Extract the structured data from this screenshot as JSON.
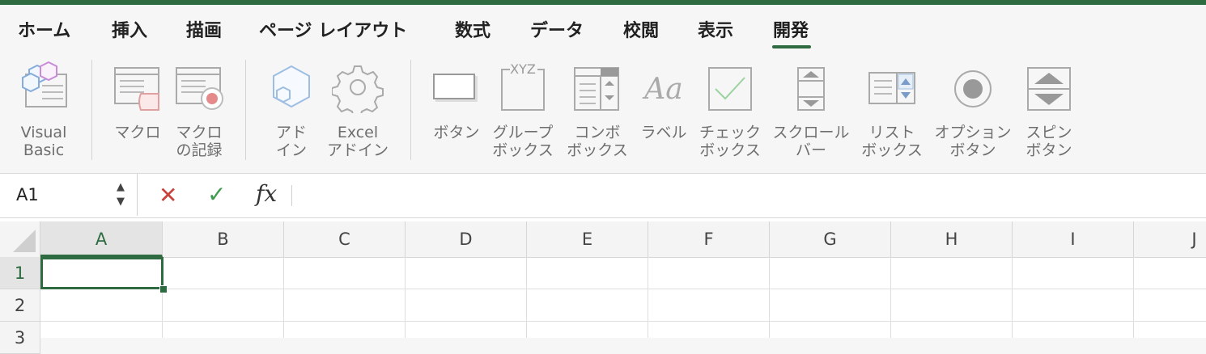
{
  "ribbon_tabs": [
    {
      "label": "ホーム"
    },
    {
      "label": "挿入"
    },
    {
      "label": "描画"
    },
    {
      "label": "ページ レイアウト"
    },
    {
      "label": "数式"
    },
    {
      "label": "データ"
    },
    {
      "label": "校閲"
    },
    {
      "label": "表示"
    },
    {
      "label": "開発",
      "active": true
    }
  ],
  "ribbon": {
    "visual_basic": "Visual\nBasic",
    "macro": "マクロ",
    "record_macro": "マクロ\nの記録",
    "addins": "アド\nイン",
    "excel_addins": "Excel\nアドイン",
    "button": "ボタン",
    "group_box": "グループ\nボックス",
    "combo_box": "コンボ\nボックス",
    "label": "ラベル",
    "check_box": "チェック\nボックス",
    "scroll_bar": "スクロール\nバー",
    "list_box": "リスト\nボックス",
    "option_button": "オプション\nボタン",
    "spin_button": "スピン\nボタン",
    "group_box_icon_text": "XYZ",
    "label_icon_text": "Aa"
  },
  "formula_bar": {
    "name_box": "A1",
    "cancel_symbol": "✕",
    "enter_symbol": "✓",
    "fx_symbol": "fx",
    "formula": ""
  },
  "sheet": {
    "columns": [
      "A",
      "B",
      "C",
      "D",
      "E",
      "F",
      "G",
      "H",
      "I",
      "J"
    ],
    "rows": [
      "1",
      "2",
      "3"
    ],
    "selected_cell": "A1"
  },
  "colors": {
    "accent": "#2f6b40",
    "cancel": "#c9433e",
    "enter": "#3e9b4f",
    "ribbon_label": "#6e6e6e"
  }
}
